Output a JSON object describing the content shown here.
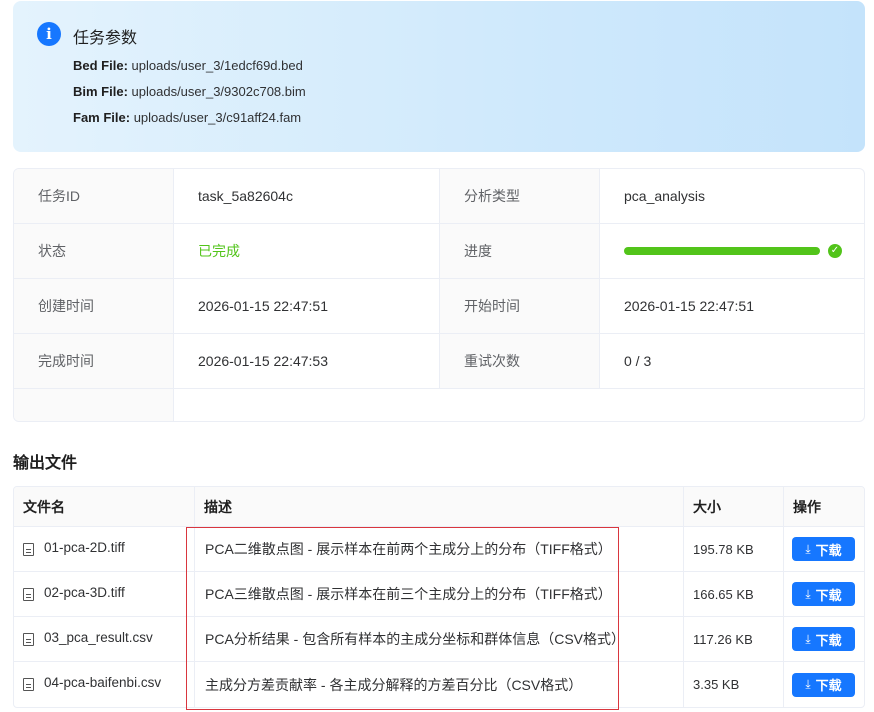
{
  "task_params": {
    "title": "任务参数",
    "icon": "info-icon",
    "params": [
      {
        "key": "Bed File:",
        "value": "uploads/user_3/1edcf69d.bed"
      },
      {
        "key": "Bim File:",
        "value": "uploads/user_3/9302c708.bim"
      },
      {
        "key": "Fam File:",
        "value": "uploads/user_3/c91aff24.fam"
      }
    ]
  },
  "details": {
    "task_id_label": "任务ID",
    "task_id": "task_5a82604c",
    "analysis_type_label": "分析类型",
    "analysis_type": "pca_analysis",
    "status_label": "状态",
    "status": "已完成",
    "status_color": "#52c41a",
    "progress_label": "进度",
    "progress": 1.0,
    "created_label": "创建时间",
    "created": "2026-01-15 22:47:51",
    "started_label": "开始时间",
    "started": "2026-01-15 22:47:51",
    "finished_label": "完成时间",
    "finished": "2026-01-15 22:47:53",
    "retries_label": "重试次数",
    "retries": "0 / 3"
  },
  "output": {
    "title": "输出文件",
    "columns": [
      "文件名",
      "描述",
      "大小",
      "操作"
    ],
    "download_label": "下载",
    "files": [
      {
        "name": "01-pca-2D.tiff",
        "description": "PCA二维散点图 - 展示样本在前两个主成分上的分布（TIFF格式）",
        "size": "195.78 KB"
      },
      {
        "name": "02-pca-3D.tiff",
        "description": "PCA三维散点图 - 展示样本在前三个主成分上的分布（TIFF格式）",
        "size": "166.65 KB"
      },
      {
        "name": "03_pca_result.csv",
        "description": "PCA分析结果 - 包含所有样本的主成分坐标和群体信息（CSV格式）",
        "size": "117.26 KB"
      },
      {
        "name": "04-pca-baifenbi.csv",
        "description": "主成分方差贡献率 - 各主成分解释的方差百分比（CSV格式）",
        "size": "3.35 KB"
      }
    ]
  },
  "colors": {
    "primary": "#1677ff",
    "success": "#52c41a",
    "highlight_border": "#d9363e"
  }
}
